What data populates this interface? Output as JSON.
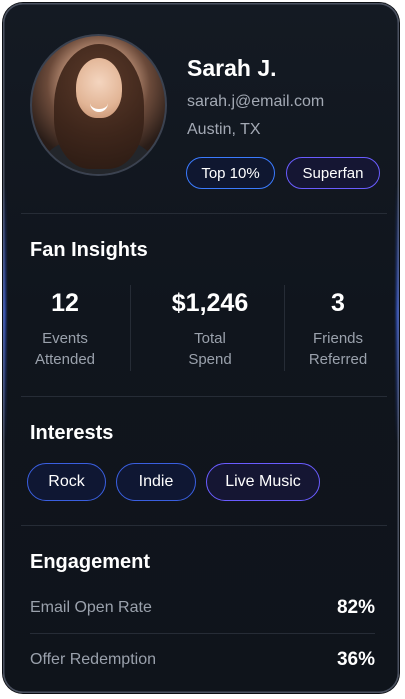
{
  "profile": {
    "name": "Sarah J.",
    "email": "sarah.j@email.com",
    "location": "Austin, TX",
    "badges": [
      "Top 10%",
      "Superfan"
    ]
  },
  "insights": {
    "title": "Fan Insights",
    "stats": [
      {
        "value": "12",
        "label": "Events\nAttended"
      },
      {
        "value": "$1,246",
        "label": "Total\nSpend"
      },
      {
        "value": "3",
        "label": "Friends\nReferred"
      }
    ]
  },
  "interests": {
    "title": "Interests",
    "items": [
      "Rock",
      "Indie",
      "Live Music"
    ]
  },
  "engagement": {
    "title": "Engagement",
    "rows": [
      {
        "label": "Email Open Rate",
        "value": "82%"
      },
      {
        "label": "Offer Redemption",
        "value": "36%"
      }
    ]
  },
  "colors": {
    "accent_blue": "#3b7bff",
    "accent_purple": "#6a5cff",
    "card_bg": "#141a23"
  }
}
